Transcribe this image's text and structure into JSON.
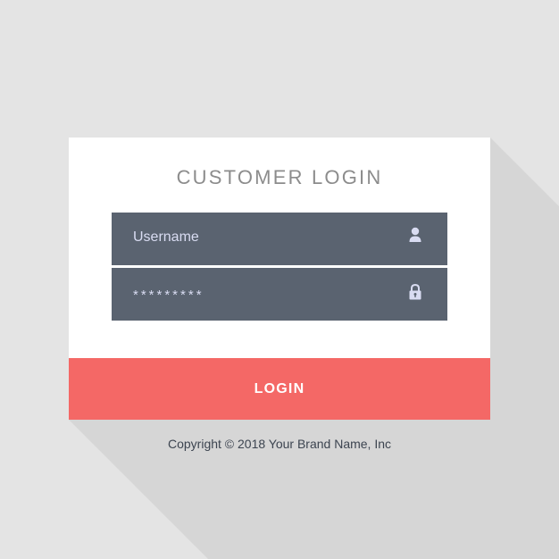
{
  "login_form": {
    "title": "CUSTOMER LOGIN",
    "username": {
      "placeholder": "Username",
      "icon": "user-icon"
    },
    "password": {
      "value": "*********",
      "icon": "lock-icon"
    },
    "submit_label": "LOGIN"
  },
  "footer": {
    "copyright": "Copyright © 2018 Your Brand Name, Inc"
  },
  "colors": {
    "background": "#e4e4e4",
    "card": "#ffffff",
    "field": "#5a6370",
    "field_text": "#d9dcf2",
    "button": "#f46866",
    "title_text": "#8c8c8c",
    "copyright_text": "#3c4450"
  }
}
